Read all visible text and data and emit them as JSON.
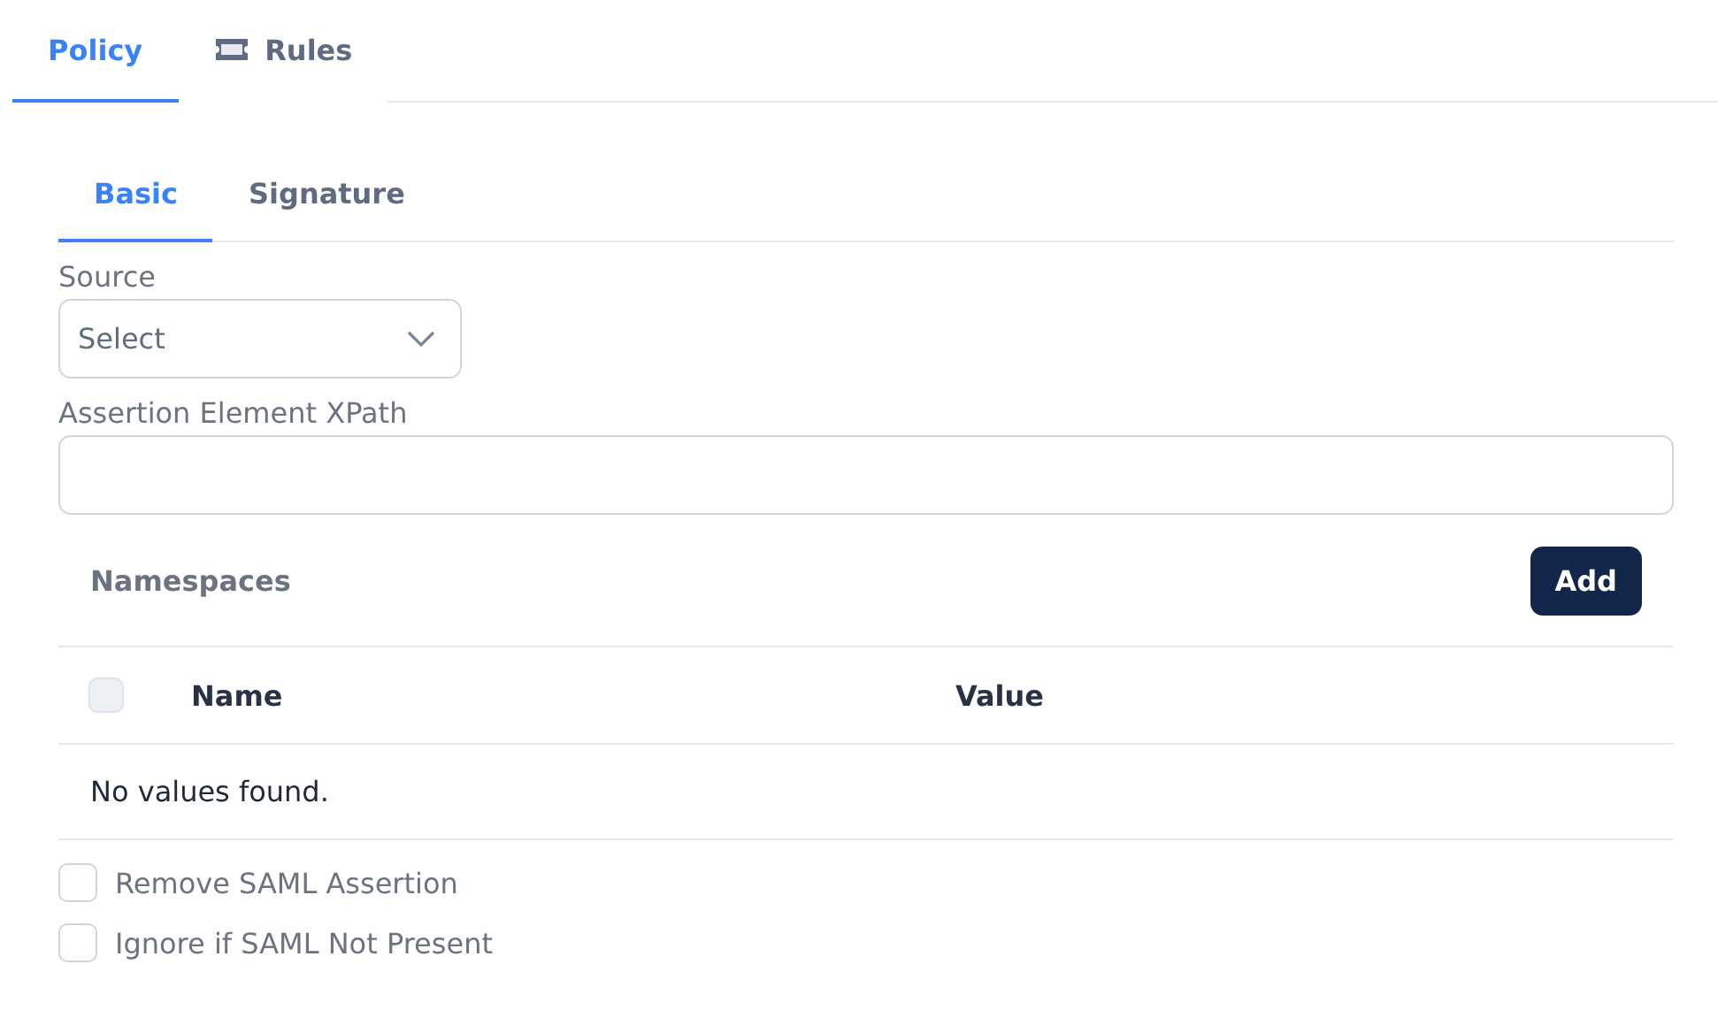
{
  "tabs": [
    {
      "label": "Policy",
      "selected": true
    },
    {
      "label": "Rules",
      "selected": false
    }
  ],
  "subtabs": [
    {
      "label": "Basic",
      "selected": true
    },
    {
      "label": "Signature",
      "selected": false
    }
  ],
  "source": {
    "label": "Source",
    "placeholder": "Select"
  },
  "xpath": {
    "label": "Assertion Element XPath"
  },
  "namespaces": {
    "title": "Namespaces",
    "add_button": "Add",
    "select_all_checked": false,
    "columns": [
      "Name",
      "Value"
    ],
    "empty_text": "No values found."
  },
  "options": [
    {
      "label": "Remove SAML Assertion",
      "checked": false
    },
    {
      "label": "Ignore if SAML Not Present",
      "checked": false
    }
  ]
}
